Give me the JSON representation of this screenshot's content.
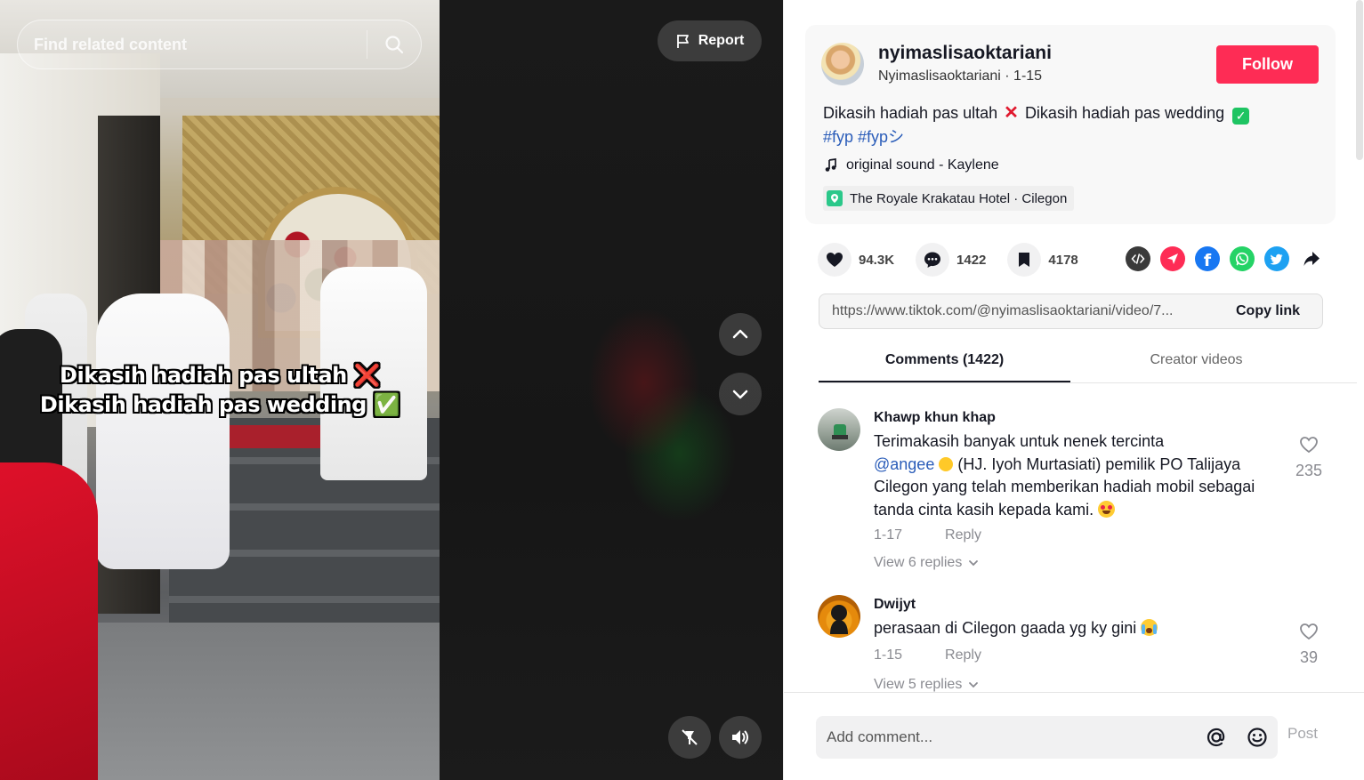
{
  "video": {
    "search_placeholder": "Find related content",
    "report_label": "Report",
    "overlay_line1": "Dikasih hadiah pas ultah ❌",
    "overlay_line2": "Dikasih hadiah pas wedding ✅"
  },
  "author": {
    "handle": "nyimaslisaoktariani",
    "subline": "Nyimaslisaoktariani · 1-15",
    "follow_label": "Follow"
  },
  "post": {
    "caption_part1": "Dikasih hadiah pas ultah",
    "caption_part2": "Dikasih hadiah pas wedding",
    "hashtag1": "#fyp",
    "hashtag2": "#fypシ",
    "sound": "original sound - Kaylene",
    "location": "The Royale Krakatau Hotel · Cilegon"
  },
  "stats": {
    "likes": "94.3K",
    "comments": "1422",
    "bookmarks": "4178"
  },
  "share": {
    "link": "https://www.tiktok.com/@nyimaslisaoktariani/video/7...",
    "copy_label": "Copy link",
    "colors": {
      "embed": "#3a3a3a",
      "send": "#fe2c55",
      "facebook": "#1877f2",
      "whatsapp": "#25d366",
      "twitter": "#1da1f2"
    }
  },
  "tabs": {
    "comments": "Comments (1422)",
    "creator_videos": "Creator videos"
  },
  "comments": [
    {
      "user": "Khawp khun khap",
      "text_line1": "Terimakasih banyak untuk nenek tercinta",
      "mention": "@angee",
      "text_rest": "(HJ. Iyoh Murtasiati) pemilik PO Talijaya Cilegon yang telah memberikan hadiah mobil sebagai tanda cinta kasih kepada kami.",
      "date": "1-17",
      "reply_label": "Reply",
      "view_replies": "View 6 replies",
      "likes": "235"
    },
    {
      "user": "Dwijyt",
      "text": "perasaan di Cilegon gaada yg ky gini",
      "date": "1-15",
      "reply_label": "Reply",
      "view_replies": "View 5 replies",
      "likes": "39"
    }
  ],
  "composer": {
    "placeholder": "Add comment...",
    "post_label": "Post"
  },
  "theme": {
    "accent": "#fe2c55",
    "link": "#2b5db9"
  }
}
